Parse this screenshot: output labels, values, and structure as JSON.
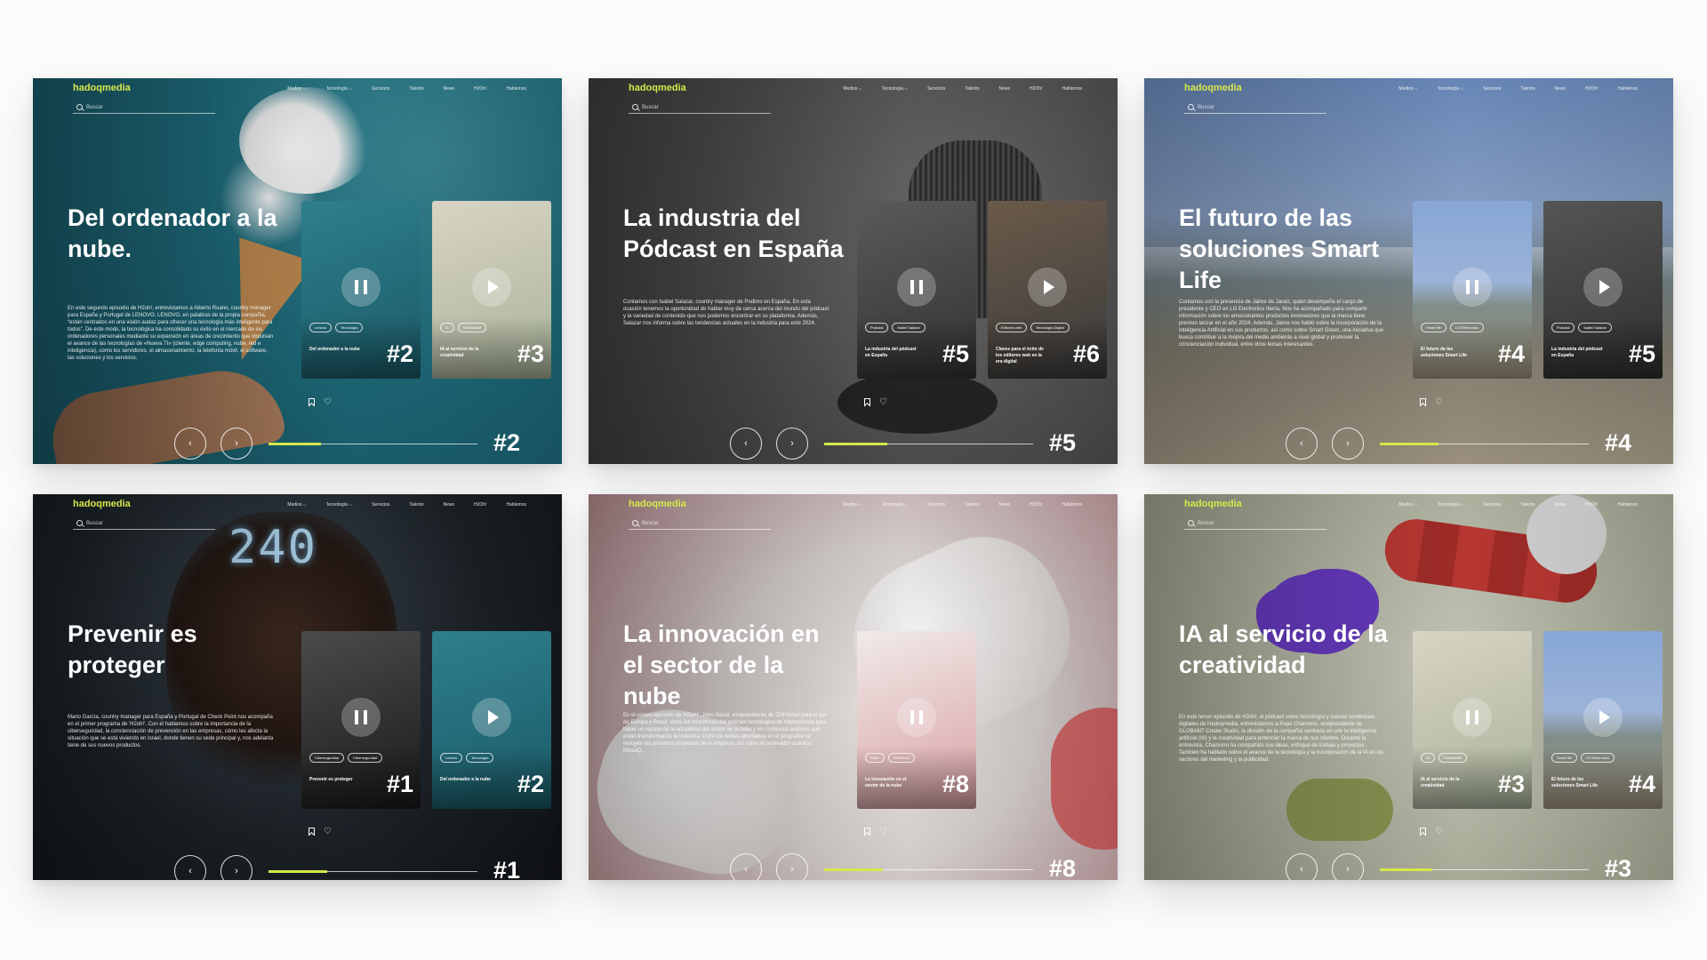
{
  "brand": {
    "logo": "hadoqmedia",
    "accent": "#d6e84a"
  },
  "nav": [
    "Medios ⌵",
    "Tecnología ⌵",
    "Servicios",
    "Talento",
    "News",
    "H2Oh!",
    "Hablemos"
  ],
  "search_placeholder": "Buscar",
  "pager": {
    "prev": "‹",
    "next": "›"
  },
  "panels": [
    {
      "title": "Del ordenador a la nube.",
      "description": "En este segundo episodio de H2oh!, entrevistamos a Alberto Ruano, country manager para España y Portugal de LENOVO. LENOVO, en palabras de la propia compañía, “están centrados en una visión audaz para ofrecer una tecnología más inteligente para todos”. De este modo, la tecnológica ha consolidado su éxito en el mercado de los ordenadores personales mediante su expansión en áreas de crecimiento que impulsan el avance de las tecnologías de «Nueva TI» (cliente, edge computing, nube, red e inteligencia), como los servidores, el almacenamiento, la telefonía móvil, el software, las soluciones y los servicios.",
      "current": "#2",
      "progress": 0.25,
      "cards": [
        {
          "name": "Del ordenador a la nube",
          "number": "#2",
          "tags": [
            "Lenovo",
            "Tecnología"
          ],
          "state": "pause"
        },
        {
          "name": "IA al servicio de la creatividad",
          "number": "#3",
          "tags": [
            "IA",
            "Creatividad"
          ],
          "state": "play"
        }
      ]
    },
    {
      "title": "La industria del Pódcast en España",
      "description": "Contamos con Isabel Salazar, country manager de Podimo en España. En esta ocasión tenemos la oportunidad de hablar muy de cerca acerca del mundo del pódcast y la variedad de contenido que nos podemos encontrar en su plataforma. Además, Salazar nos informa sobre las tendencias actuales en la industria para este 2024.",
      "current": "#5",
      "progress": 0.3,
      "cards": [
        {
          "name": "La industria del pódcast en España",
          "number": "#5",
          "tags": [
            "Podcast",
            "Isabel Salazar"
          ],
          "state": "pause"
        },
        {
          "name": "Claves para el éxito de los editores web en la era digital",
          "number": "#6",
          "tags": [
            "Editores web",
            "Tecnología Digital"
          ],
          "state": "play"
        }
      ]
    },
    {
      "title": "El futuro de las soluciones Smart Life",
      "description": "Contamos con la presencia de Jaime de Jaraiz, quien desempeña el cargo de presidente y CEO en LG Electronics Iberia. Nos ha acompañado para compartir información sobre los emocionantes productos innovadores que la marca tiene previsto lanzar en el año 2024. Además, Jaime nos habló sobre la incorporación de la Inteligencia Artificial en sus productos, así como sobre Smart Green, una iniciativa que busca contribuir a la mejora del medio ambiente a nivel global y promover la concienciación individual, entre otros temas interesantes.",
      "current": "#4",
      "progress": 0.28,
      "cards": [
        {
          "name": "El futuro de las soluciones Smart Life",
          "number": "#4",
          "tags": [
            "Smart life",
            "LG Electronics"
          ],
          "state": "pause"
        },
        {
          "name": "La industria del pódcast en España",
          "number": "#5",
          "tags": [
            "Podcast",
            "Isabel Salazar"
          ],
          "state": "play"
        }
      ]
    },
    {
      "title": "Prevenir es proteger",
      "description": "Mario García, country manager para España y Portugal de Check Point nos acompaña en el primer programa de 'H2oh!'. Con él hablamos sobre la importancia de la ciberseguridad, la concienciación de prevención en las empresas, cómo les afecta la situación que se está viviendo en Israel, donde tienen su sede principal y, nos adelanta tiene de sus nuevos productos.",
      "current": "#1",
      "progress": 0.28,
      "cards": [
        {
          "name": "Prevenir es proteger",
          "number": "#1",
          "tags": [
            "Ciberseguridad",
            "Ciberseguridad"
          ],
          "state": "pause"
        },
        {
          "name": "Del ordenador a la nube",
          "number": "#2",
          "tags": [
            "Lenovo",
            "Tecnología"
          ],
          "state": "play"
        }
      ]
    },
    {
      "title": "La innovación en el sector de la nube",
      "description": "En el octavo episodio de 'H2oh!', John Gazal, vicepresidente de OVHcloud para el sur de Europa y Brasil, visita los micrófonos del pódcast tecnológico de Hadoqmedia para hacer un repaso de la actualidad del sector de la nube y los continuos avances que están transformando la industria. Entre los temas abordados en el programa se incluyen los próximos proyectos de la empresa, así como el ordenador cuántico MosaiQ.",
      "current": "#8",
      "progress": 0.28,
      "cards": [
        {
          "name": "La innovación en el sector de la nube",
          "number": "#8",
          "tags": [
            "Nube",
            "OVHcloud"
          ],
          "state": "pause"
        }
      ]
    },
    {
      "title": "IA al servicio de la creatividad",
      "description": "En este tercer episodio de H2oh!, el pódcast sobre tecnología y nuevas tendencias digitales de Hadoqmedia, entrevistamos a Pepe Chamorro, vicepresidente de GLOBANT Create Studio, la división de la compañía centrada en unir la inteligencia artificial (IA) y la creatividad para potenciar la marca de sus clientes. Durante la entrevista, Chamorro ha compartido sus ideas, enfoque de trabajo y proyectos. También ha hablado sobre el avance de la tecnología y la incorporación de la IA en los sectores del marketing y la publicidad.",
      "current": "#3",
      "progress": 0.25,
      "cards": [
        {
          "name": "IA al servicio de la creatividad",
          "number": "#3",
          "tags": [
            "IA",
            "Creatividad"
          ],
          "state": "pause"
        },
        {
          "name": "El futuro de las soluciones Smart Life",
          "number": "#4",
          "tags": [
            "Smart life",
            "LG Electronics"
          ],
          "state": "play"
        }
      ]
    }
  ]
}
